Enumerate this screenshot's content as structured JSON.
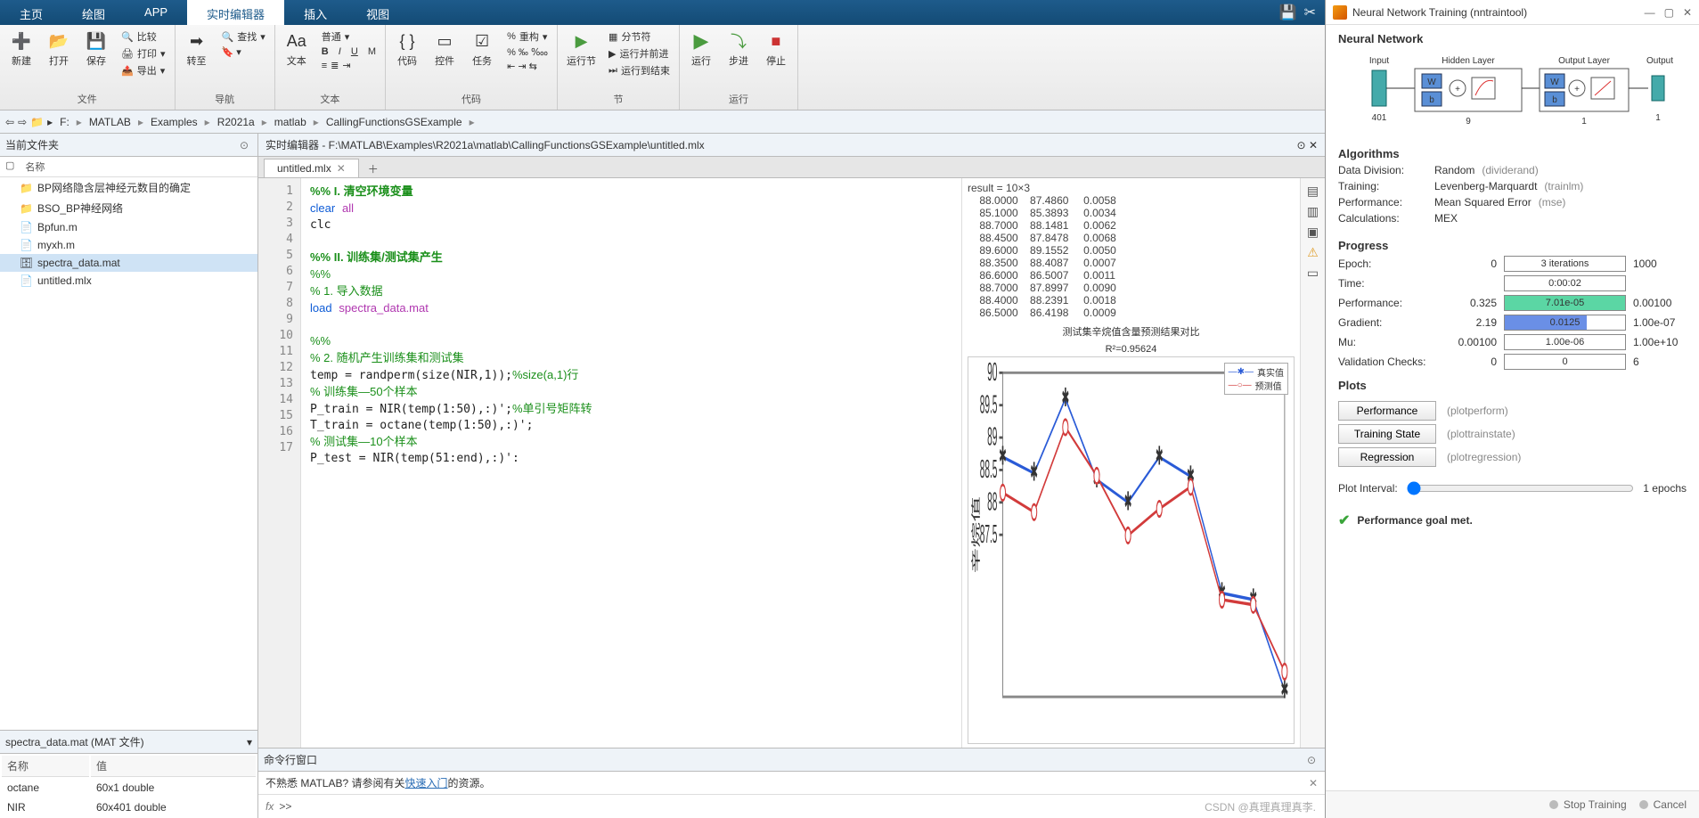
{
  "toptabs": [
    "主页",
    "绘图",
    "APP",
    "实时编辑器",
    "插入",
    "视图"
  ],
  "toptab_active": 3,
  "ribbon_groups": {
    "file": {
      "label": "文件",
      "new": "新建",
      "open": "打开",
      "save": "保存",
      "compare": "比较",
      "print": "打印",
      "export": "导出"
    },
    "nav": {
      "label": "导航",
      "goto": "转至",
      "find": "查找"
    },
    "text": {
      "label": "文本",
      "normal": "普通"
    },
    "code": {
      "label": "代码",
      "btn1": "代码",
      "btn2": "控件",
      "btn3": "任务",
      "refactor": "重构"
    },
    "section": {
      "label": "节",
      "runsec": "运行节",
      "split": "分节符",
      "runadv": "运行并前进",
      "runend": "运行到结束"
    },
    "run": {
      "label": "运行",
      "run": "运行",
      "step": "步进",
      "stop": "停止"
    }
  },
  "breadcrumb": [
    "F:",
    "MATLAB",
    "Examples",
    "R2021a",
    "matlab",
    "CallingFunctionsGSExample"
  ],
  "curfolder": {
    "title": "当前文件夹",
    "namehdr": "名称"
  },
  "files": [
    {
      "name": "BP网络隐含层神经元数目的确定",
      "ico": "📁",
      "sel": false
    },
    {
      "name": "BSO_BP神经网络",
      "ico": "📁",
      "sel": false
    },
    {
      "name": "Bpfun.m",
      "ico": "📄",
      "sel": false
    },
    {
      "name": "myxh.m",
      "ico": "📄",
      "sel": false
    },
    {
      "name": "spectra_data.mat",
      "ico": "🗄",
      "sel": true
    },
    {
      "name": "untitled.mlx",
      "ico": "📄",
      "sel": false
    }
  ],
  "wstitle": "spectra_data.mat  (MAT 文件)",
  "wshdr": {
    "name": "名称",
    "value": "值"
  },
  "wsrows": [
    {
      "name": "octane",
      "value": "60x1 double"
    },
    {
      "name": "NIR",
      "value": "60x401 double"
    }
  ],
  "editor": {
    "title": "实时编辑器 - F:\\MATLAB\\Examples\\R2021a\\matlab\\CallingFunctionsGSExample\\untitled.mlx",
    "tab": "untitled.mlx",
    "lines": [
      {
        "n": 1,
        "type": "sec",
        "t": "%% I. 清空环境变量"
      },
      {
        "n": 2,
        "type": "kw",
        "t": "clear all"
      },
      {
        "n": 3,
        "type": "plain",
        "t": "clc"
      },
      {
        "n": 4,
        "type": "plain",
        "t": ""
      },
      {
        "n": 5,
        "type": "sec",
        "t": "%% II. 训练集/测试集产生"
      },
      {
        "n": 6,
        "type": "com",
        "t": "%%"
      },
      {
        "n": 7,
        "type": "com",
        "t": "% 1. 导入数据"
      },
      {
        "n": 8,
        "type": "load",
        "t": "load spectra_data.mat"
      },
      {
        "n": 9,
        "type": "plain",
        "t": ""
      },
      {
        "n": 10,
        "type": "com",
        "t": "%%"
      },
      {
        "n": 11,
        "type": "com",
        "t": "% 2. 随机产生训练集和测试集"
      },
      {
        "n": 12,
        "type": "plain",
        "t": "temp = randperm(size(NIR,1));%size(a,1)行"
      },
      {
        "n": 13,
        "type": "com",
        "t": "% 训练集—50个样本"
      },
      {
        "n": 14,
        "type": "plain",
        "t": "P_train = NIR(temp(1:50),:)';%单引号矩阵转"
      },
      {
        "n": 15,
        "type": "plain",
        "t": "T_train = octane(temp(1:50),:)';"
      },
      {
        "n": 16,
        "type": "com",
        "t": "% 测试集—10个样本"
      },
      {
        "n": 17,
        "type": "plain",
        "t": "P_test = NIR(temp(51:end),:)':"
      }
    ]
  },
  "output": {
    "header": "result = 10×3",
    "rows": [
      [
        "88.0000",
        "87.4860",
        "0.0058"
      ],
      [
        "85.1000",
        "85.3893",
        "0.0034"
      ],
      [
        "88.7000",
        "88.1481",
        "0.0062"
      ],
      [
        "88.4500",
        "87.8478",
        "0.0068"
      ],
      [
        "89.6000",
        "89.1552",
        "0.0050"
      ],
      [
        "88.3500",
        "88.4087",
        "0.0007"
      ],
      [
        "86.6000",
        "86.5007",
        "0.0011"
      ],
      [
        "88.7000",
        "87.8997",
        "0.0090"
      ],
      [
        "88.4000",
        "88.2391",
        "0.0018"
      ],
      [
        "86.5000",
        "86.4198",
        "0.0009"
      ]
    ],
    "fig_title": "测试集辛烷值含量预测结果对比",
    "fig_sub": "R²=0.95624",
    "legend": [
      "真实值",
      "预测值"
    ]
  },
  "chart_data": {
    "type": "line",
    "title": "测试集辛烷值含量预测结果对比",
    "subtitle": "R²=0.95624",
    "x": [
      1,
      2,
      3,
      4,
      5,
      6,
      7,
      8,
      9,
      10
    ],
    "series": [
      {
        "name": "真实值",
        "color": "#2a5bd7",
        "marker": "*",
        "values": [
          88.7,
          88.45,
          89.6,
          88.35,
          88.0,
          88.7,
          88.4,
          86.6,
          86.5,
          85.1
        ]
      },
      {
        "name": "预测值",
        "color": "#d23b3b",
        "marker": "o",
        "values": [
          88.15,
          87.85,
          89.16,
          88.41,
          87.49,
          87.9,
          88.24,
          86.5,
          86.42,
          85.39
        ]
      }
    ],
    "ylabel": "辛烷值",
    "ylim": [
      85,
      90
    ],
    "yticks": [
      87.5,
      88,
      88.5,
      89,
      89.5,
      90
    ]
  },
  "cmd": {
    "title": "命令行窗口",
    "hint_pre": "不熟悉 MATLAB? 请参阅有关",
    "hint_link": "快速入门",
    "hint_post": "的资源。",
    "prompt": ">>"
  },
  "train": {
    "title": "Neural Network Training (nntraintool)",
    "nn_labels": {
      "input": "Input",
      "hidden": "Hidden Layer",
      "output": "Output Layer",
      "out": "Output",
      "in_n": "401",
      "hid_n": "9",
      "out_n": "1",
      "out2": "1"
    },
    "sec_nn": "Neural Network",
    "sec_algo": "Algorithms",
    "algo": [
      {
        "k": "Data Division:",
        "v": "Random",
        "s": "(dividerand)"
      },
      {
        "k": "Training:",
        "v": "Levenberg-Marquardt",
        "s": "(trainlm)"
      },
      {
        "k": "Performance:",
        "v": "Mean Squared Error",
        "s": "(mse)"
      },
      {
        "k": "Calculations:",
        "v": "MEX",
        "s": ""
      }
    ],
    "sec_prog": "Progress",
    "prog": [
      {
        "k": "Epoch:",
        "l": "0",
        "c": "3 iterations",
        "r": "1000",
        "fill": 0.003,
        "color": "#fff"
      },
      {
        "k": "Time:",
        "l": "",
        "c": "0:00:02",
        "r": "",
        "fill": 0,
        "color": "#fff"
      },
      {
        "k": "Performance:",
        "l": "0.325",
        "c": "7.01e-05",
        "r": "0.00100",
        "fill": 1,
        "color": "#5bd6a4"
      },
      {
        "k": "Gradient:",
        "l": "2.19",
        "c": "0.0125",
        "r": "1.00e-07",
        "fill": 0.68,
        "color": "#6a8fe6"
      },
      {
        "k": "Mu:",
        "l": "0.00100",
        "c": "1.00e-06",
        "r": "1.00e+10",
        "fill": 0,
        "color": "#fff"
      },
      {
        "k": "Validation Checks:",
        "l": "0",
        "c": "0",
        "r": "6",
        "fill": 0,
        "color": "#fff"
      }
    ],
    "sec_plots": "Plots",
    "plots": [
      {
        "b": "Performance",
        "s": "(plotperform)"
      },
      {
        "b": "Training State",
        "s": "(plottrainstate)"
      },
      {
        "b": "Regression",
        "s": "(plotregression)"
      }
    ],
    "interval_label": "Plot Interval:",
    "interval_val": "1 epochs",
    "status": "Performance goal met.",
    "foot": {
      "stop": "Stop Training",
      "cancel": "Cancel"
    }
  },
  "watermark": "CSDN @真理真理真李."
}
